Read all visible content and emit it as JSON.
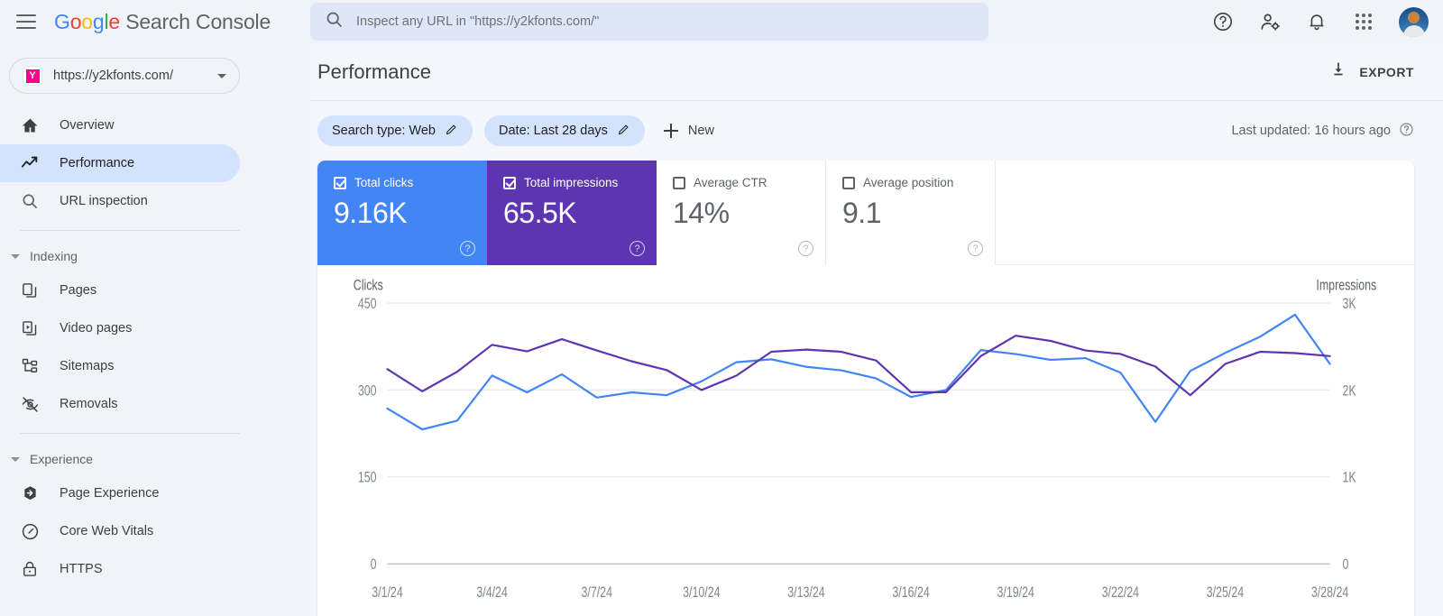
{
  "header": {
    "menu_icon": "hamburger-icon",
    "brand": {
      "g": "G",
      "o1": "o",
      "o2": "o",
      "g2": "g",
      "l": "l",
      "e": "e",
      "suffix": " Search Console"
    },
    "search": {
      "placeholder": "Inspect any URL in \"https://y2kfonts.com/\"",
      "value": "",
      "icon": "search-icon"
    },
    "icons": [
      "help-icon",
      "account-settings-icon",
      "notifications-bell-icon",
      "apps-grid-icon",
      "avatar"
    ]
  },
  "sidebar": {
    "property": {
      "favicon_letter": "Y",
      "url": "https://y2kfonts.com/",
      "caret": "chevron-down-icon"
    },
    "items": [
      {
        "label": "Overview",
        "icon": "home-icon",
        "active": false
      },
      {
        "label": "Performance",
        "icon": "trending-up-icon",
        "active": true
      },
      {
        "label": "URL inspection",
        "icon": "search-icon",
        "active": false
      }
    ],
    "sections": [
      {
        "label": "Indexing",
        "items": [
          {
            "label": "Pages",
            "icon": "pages-icon"
          },
          {
            "label": "Video pages",
            "icon": "video-pages-icon"
          },
          {
            "label": "Sitemaps",
            "icon": "sitemaps-icon"
          },
          {
            "label": "Removals",
            "icon": "eye-off-icon"
          }
        ]
      },
      {
        "label": "Experience",
        "items": [
          {
            "label": "Page Experience",
            "icon": "page-experience-icon"
          },
          {
            "label": "Core Web Vitals",
            "icon": "speedometer-icon"
          },
          {
            "label": "HTTPS",
            "icon": "lock-icon"
          }
        ]
      }
    ]
  },
  "main": {
    "title": "Performance",
    "export": {
      "label": "EXPORT",
      "icon": "download-icon"
    },
    "filters": [
      {
        "label": "Search type: Web",
        "icon": "pencil-icon"
      },
      {
        "label": "Date: Last 28 days",
        "icon": "pencil-icon"
      }
    ],
    "new_filter": {
      "label": "New",
      "icon": "plus-icon"
    },
    "last_updated": {
      "label": "Last updated: 16 hours ago",
      "icon": "help-icon"
    },
    "metrics": [
      {
        "label": "Total clicks",
        "value": "9.16K",
        "checked": true,
        "style": "sel-blue",
        "color": "#4285F4"
      },
      {
        "label": "Total impressions",
        "value": "65.5K",
        "checked": true,
        "style": "sel-purple",
        "color": "#5e35b1"
      },
      {
        "label": "Average CTR",
        "value": "14%",
        "checked": false,
        "style": "plain"
      },
      {
        "label": "Average position",
        "value": "9.1",
        "checked": false,
        "style": "plain"
      }
    ]
  },
  "chart_data": {
    "type": "line",
    "title": "",
    "xlabel": "",
    "ylabel": "Clicks",
    "y2label": "Impressions",
    "grid": true,
    "legend_position": "none",
    "x": [
      "3/1/24",
      "3/2/24",
      "3/3/24",
      "3/4/24",
      "3/5/24",
      "3/6/24",
      "3/7/24",
      "3/8/24",
      "3/9/24",
      "3/10/24",
      "3/11/24",
      "3/12/24",
      "3/13/24",
      "3/14/24",
      "3/15/24",
      "3/16/24",
      "3/17/24",
      "3/18/24",
      "3/19/24",
      "3/20/24",
      "3/21/24",
      "3/22/24",
      "3/23/24",
      "3/24/24",
      "3/25/24",
      "3/26/24",
      "3/27/24",
      "3/28/24"
    ],
    "xtick_labels": [
      "3/1/24",
      "3/4/24",
      "3/7/24",
      "3/10/24",
      "3/13/24",
      "3/16/24",
      "3/19/24",
      "3/22/24",
      "3/25/24",
      "3/28/24"
    ],
    "xtick_indices": [
      0,
      3,
      6,
      9,
      12,
      15,
      18,
      21,
      24,
      27
    ],
    "ylim": [
      0,
      450
    ],
    "ytick_labels": [
      "0",
      "150",
      "300",
      "450"
    ],
    "ytick_values": [
      0,
      150,
      300,
      450
    ],
    "y2lim": [
      0,
      3000
    ],
    "y2tick_labels": [
      "0",
      "1K",
      "2K",
      "3K"
    ],
    "y2tick_values": [
      0,
      1000,
      2000,
      3000
    ],
    "series": [
      {
        "name": "Total clicks",
        "color": "#4285F4",
        "axis": "left",
        "values": [
          268,
          232,
          247,
          325,
          296,
          327,
          287,
          296,
          291,
          315,
          348,
          353,
          340,
          334,
          320,
          288,
          300,
          369,
          362,
          352,
          355,
          330,
          245,
          333,
          364,
          392,
          430,
          345
        ]
      },
      {
        "name": "Total impressions",
        "color": "#5e35b1",
        "axis": "right",
        "values": [
          2240,
          1985,
          2210,
          2520,
          2445,
          2585,
          2455,
          2330,
          2230,
          2000,
          2165,
          2440,
          2465,
          2440,
          2340,
          1975,
          1975,
          2390,
          2625,
          2565,
          2455,
          2415,
          2270,
          1940,
          2300,
          2440,
          2425,
          2390
        ]
      }
    ]
  }
}
